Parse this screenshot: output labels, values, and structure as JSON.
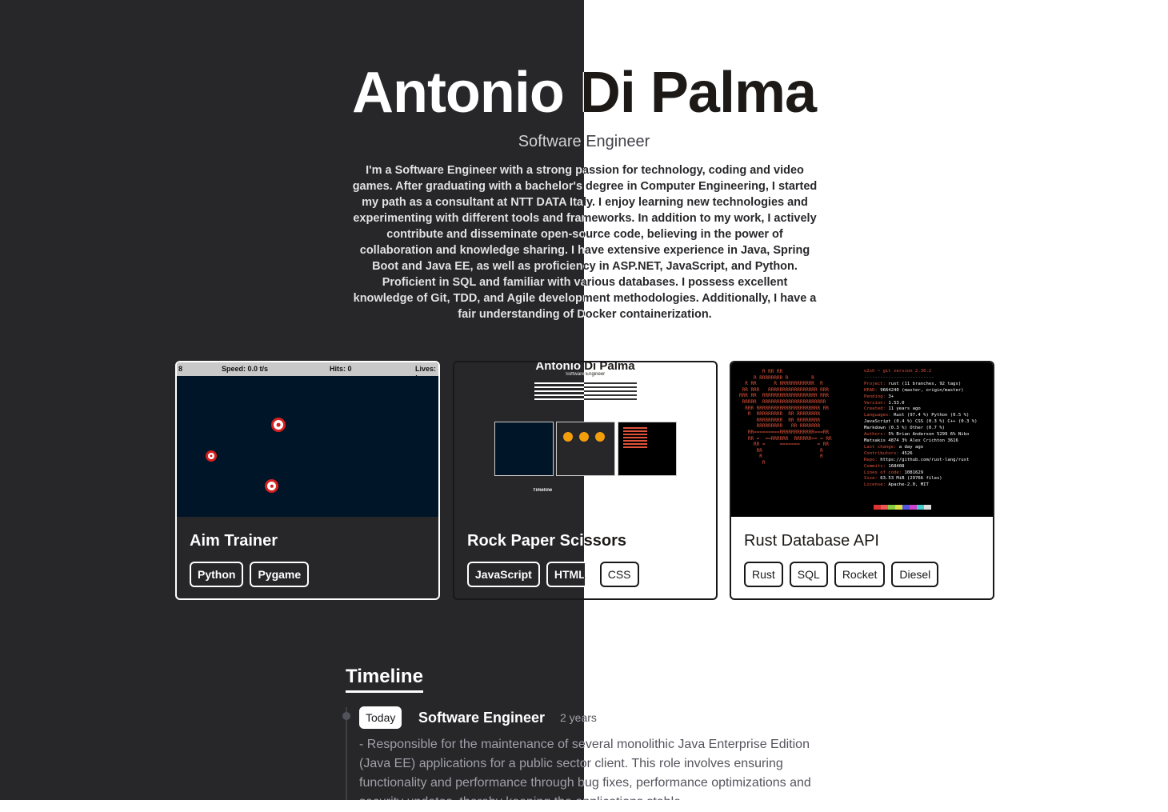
{
  "header": {
    "name": "Antonio Di Palma",
    "role": "Software Engineer",
    "bio": "I'm a Software Engineer with a strong passion for technology, coding and video games. After graduating with a bachelor's degree in Computer Engineering, I started my path as a consultant at NTT DATA Italy. I enjoy learning new technologies and experimenting with different tools and frameworks. In addition to my work, I actively contribute and disseminate open-source code, believing in the power of collaboration and knowledge sharing. I have extensive experience in Java, Spring Boot and Java EE, as well as proficiency in ASP.NET, JavaScript, and Python. Proficient in SQL and familiar with various databases. I possess excellent knowledge of Git, TDD, and Agile development methodologies. Additionally, I have a fair understanding of Docker containerization."
  },
  "projects": [
    {
      "title": "Aim Trainer",
      "tags": [
        "Python",
        "Pygame"
      ],
      "thumb": {
        "left": "8",
        "speed": "Speed: 0.0 t/s",
        "hits": "Hits: 0",
        "lives": "Lives: :"
      }
    },
    {
      "title": "Rock Paper Scissors",
      "tags": [
        "JavaScript",
        "HTML",
        "CSS"
      ],
      "thumb": {
        "title": "Antonio Di Palma",
        "sub": "Software Engineer",
        "timeline": "Timeline"
      }
    },
    {
      "title": "Rust Database API",
      "tags": [
        "Rust",
        "SQL",
        "Rocket",
        "Diesel"
      ],
      "thumb": {
        "prompt": "o2sh ~ git version 2.30.2",
        "rows": [
          {
            "k": "Project:",
            "v": "rust (11 branches, 92 tags)"
          },
          {
            "k": "HEAD:",
            "v": "9664240 (master, origin/master)"
          },
          {
            "k": "Pending:",
            "v": "3+"
          },
          {
            "k": "Version:",
            "v": "1.53.0"
          },
          {
            "k": "Created:",
            "v": "11 years ago"
          },
          {
            "k": "Languages:",
            "v": "Rust (97.4 %) Python (0.5 %) JavaScript (0.4 %) CSS (0.3 %) C++ (0.3 %) Markdown (0.3 %) Other (0.7 %)"
          },
          {
            "k": "Authors:",
            "v": "5% Brian Anderson 5299 6% Niko Matsakis 4874 3% Alex Crichton 3616"
          },
          {
            "k": "Last change:",
            "v": "a day ago"
          },
          {
            "k": "Contributors:",
            "v": "4526"
          },
          {
            "k": "Repo:",
            "v": "https://github.com/rust-lang/rust"
          },
          {
            "k": "Commits:",
            "v": "168408"
          },
          {
            "k": "Lines of code:",
            "v": "1081629"
          },
          {
            "k": "Size:",
            "v": "63.53 MiB (29766 files)"
          },
          {
            "k": "License:",
            "v": "Apache-2.0, MIT"
          }
        ]
      }
    }
  ],
  "timeline": {
    "heading": "Timeline",
    "entries": [
      {
        "badge": "Today",
        "title": "Software Engineer",
        "duration": "2 years",
        "description": "- Responsible for the maintenance of several monolithic Java Enterprise Edition (Java EE) applications for a public sector client. This role involves ensuring functionality and performance through bug fixes, performance optimizations and security updates, thereby keeping the applications stable"
      }
    ]
  },
  "colors": {
    "dark_bg": "#27272a",
    "light_bg": "#ffffff",
    "target_red": "#d61f1f",
    "game_bg": "#001528",
    "rust_orange": "#e0533a"
  }
}
